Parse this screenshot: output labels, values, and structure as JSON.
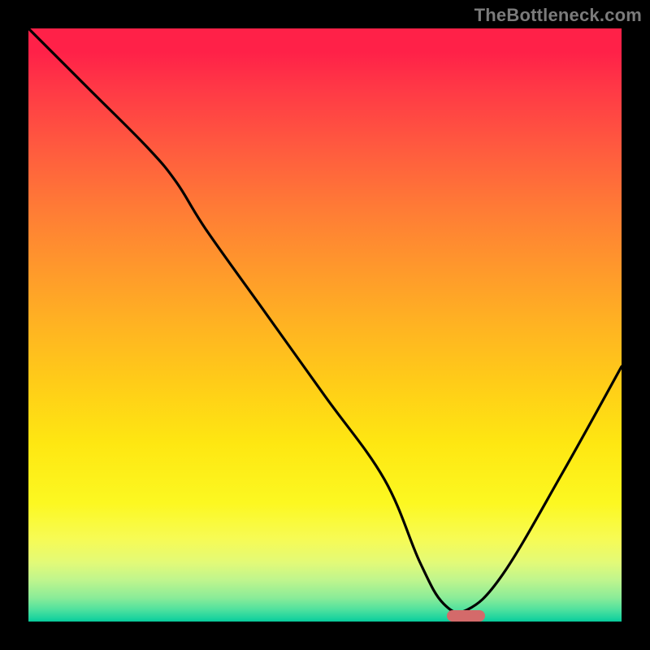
{
  "watermark": "TheBottleneck.com",
  "marker": {
    "x_frac": 0.705,
    "width_frac": 0.065,
    "color": "#d46a6a"
  },
  "chart_data": {
    "type": "line",
    "title": "",
    "xlabel": "",
    "ylabel": "",
    "xlim": [
      0,
      100
    ],
    "ylim": [
      0,
      100
    ],
    "x": [
      0,
      10,
      20,
      25,
      30,
      40,
      50,
      60,
      66,
      70,
      74,
      80,
      90,
      100
    ],
    "values": [
      100,
      90,
      80,
      74,
      66,
      52,
      38,
      24,
      10,
      3,
      2,
      8,
      25,
      43
    ],
    "annotations": [],
    "legend": [],
    "grid": false,
    "background_gradient": {
      "direction": "top-to-bottom",
      "stops": [
        {
          "pos": 0.0,
          "color": "#ff2148"
        },
        {
          "pos": 0.5,
          "color": "#ffb322"
        },
        {
          "pos": 0.8,
          "color": "#fcf821"
        },
        {
          "pos": 1.0,
          "color": "#08c99a"
        }
      ]
    },
    "marker_region": {
      "x_start": 70.5,
      "x_end": 77.0,
      "y": 0
    }
  }
}
